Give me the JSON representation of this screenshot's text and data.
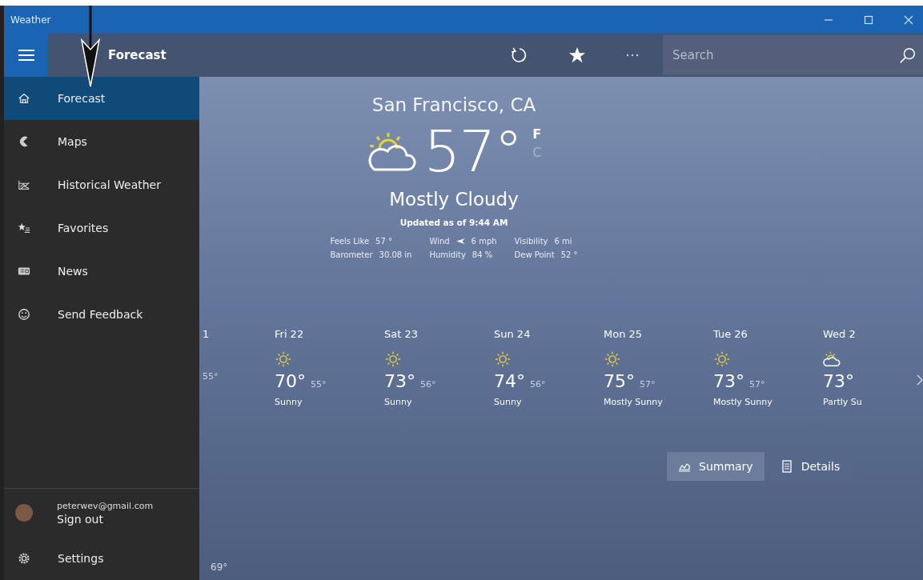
{
  "window": {
    "title": "Weather"
  },
  "header": {
    "title": "Forecast",
    "search": {
      "placeholder": "Search"
    }
  },
  "sidebar": {
    "items": [
      {
        "label": "Forecast",
        "kind": "home",
        "selected": true
      },
      {
        "label": "Maps",
        "kind": "maps",
        "selected": false
      },
      {
        "label": "Historical Weather",
        "kind": "history",
        "selected": false
      },
      {
        "label": "Favorites",
        "kind": "favorites",
        "selected": false
      },
      {
        "label": "News",
        "kind": "news",
        "selected": false
      },
      {
        "label": "Send Feedback",
        "kind": "feedback",
        "selected": false
      }
    ],
    "account": {
      "email": "peterwev@gmail.com",
      "action": "Sign out"
    },
    "settings": "Settings"
  },
  "current": {
    "location": "San Francisco, CA",
    "temperature": "57",
    "degree": "°",
    "units": [
      {
        "label": "F",
        "selected": true
      },
      {
        "label": "C",
        "selected": false
      }
    ],
    "condition": "Mostly Cloudy",
    "updated": "Updated as of 9:44 AM",
    "details": [
      {
        "label": "Feels Like",
        "value": "57 °"
      },
      {
        "label": "Wind",
        "value": "6 mph",
        "kind": "wind"
      },
      {
        "label": "Visibility",
        "value": "6 mi"
      },
      {
        "label": "Barometer",
        "value": "30.08 in"
      },
      {
        "label": "Humidity",
        "value": "84 %"
      },
      {
        "label": "Dew Point",
        "value": "52 °"
      }
    ]
  },
  "daily": [
    {
      "day": "1",
      "low": "55°"
    },
    {
      "day": "Fri 22",
      "kind": "sunny",
      "high": "70°",
      "low": "55°",
      "condition": "Sunny"
    },
    {
      "day": "Sat 23",
      "kind": "sunny",
      "high": "73°",
      "low": "56°",
      "condition": "Sunny"
    },
    {
      "day": "Sun 24",
      "kind": "sunny",
      "high": "74°",
      "low": "56°",
      "condition": "Sunny"
    },
    {
      "day": "Mon 25",
      "kind": "sunny",
      "high": "75°",
      "low": "57°",
      "condition": "Mostly Sunny"
    },
    {
      "day": "Tue 26",
      "kind": "sunny",
      "high": "73°",
      "low": "57°",
      "condition": "Mostly Sunny"
    },
    {
      "day": "Wed 2",
      "kind": "partly-cloudy",
      "high": "73°",
      "condition": "Partly Su"
    }
  ],
  "view_buttons": [
    {
      "label": "Summary",
      "kind": "chart",
      "selected": true
    },
    {
      "label": "Details",
      "kind": "list",
      "selected": false
    }
  ],
  "hourly": {
    "first_temperature": "69°"
  }
}
